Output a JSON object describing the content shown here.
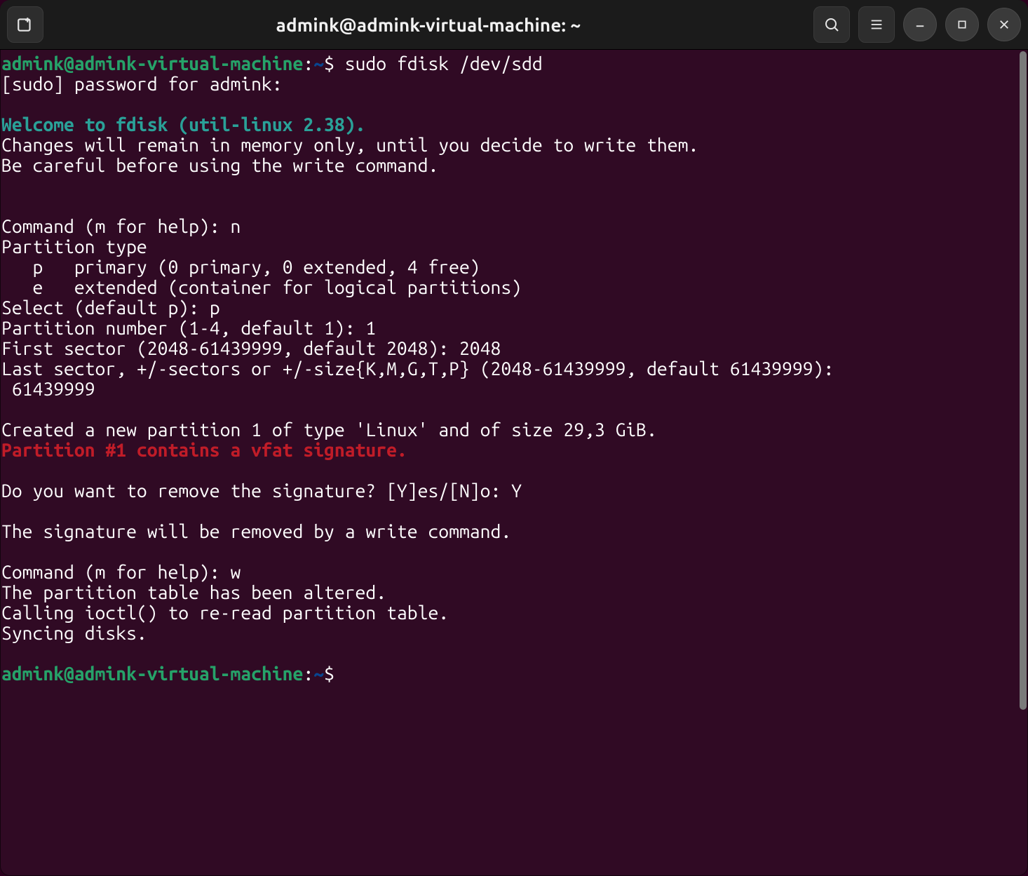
{
  "titlebar": {
    "title": "admink@admink-virtual-machine: ~"
  },
  "prompt": {
    "user_host": "admink@admink-virtual-machine",
    "sep": ":",
    "cwd": "~",
    "sigil": "$"
  },
  "session": {
    "cmd1": "sudo fdisk /dev/sdd",
    "sudo_prompt": "[sudo] password for admink: ",
    "welcome": "Welcome to fdisk (util-linux 2.38).",
    "changes": "Changes will remain in memory only, until you decide to write them.",
    "careful": "Be careful before using the write command.",
    "cmd_prompt": "Command (m for help): ",
    "input_n": "n",
    "ptype_hdr": "Partition type",
    "ptype_p": "   p   primary (0 primary, 0 extended, 4 free)",
    "ptype_e": "   e   extended (container for logical partitions)",
    "select_p": "Select (default p): ",
    "ans_p": "p",
    "pnum": "Partition number (1-4, default 1): ",
    "ans_pnum": "1",
    "fsec": "First sector (2048-61439999, default 2048): ",
    "ans_fsec": "2048",
    "lsec": "Last sector, +/-sectors or +/-size{K,M,G,T,P} (2048-61439999, default 61439999): ",
    "ans_lsec": "61439999",
    "created": "Created a new partition 1 of type 'Linux' and of size 29,3 GiB.",
    "warn": "Partition #1 contains a vfat signature.",
    "remove_q": "Do you want to remove the signature? [Y]es/[N]o: ",
    "ans_y": "Y",
    "sig_removed": "The signature will be removed by a write command.",
    "input_w": "w",
    "altered": "The partition table has been altered.",
    "ioctl": "Calling ioctl() to re-read partition table.",
    "sync": "Syncing disks."
  }
}
